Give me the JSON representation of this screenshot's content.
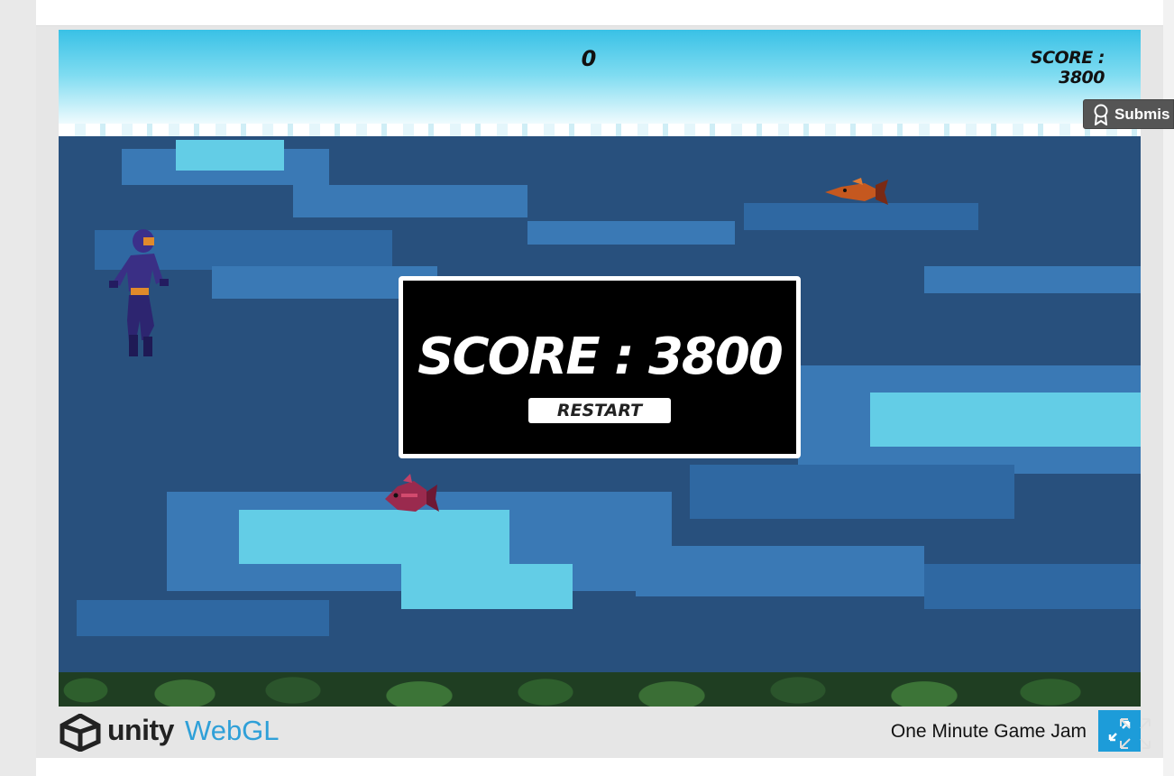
{
  "hud": {
    "timer": "0",
    "score": "SCORE : 3800"
  },
  "dialog": {
    "score": "SCORE : 3800",
    "restart_label": "RESTART"
  },
  "submission": {
    "label": "Submis",
    "icon": "ribbon-icon"
  },
  "footer": {
    "unity_label": "unity",
    "webgl_label": "WebGL",
    "game_title": "One Minute Game Jam",
    "fullscreen_icon": "fullscreen-icon"
  },
  "colors": {
    "water": "#28507d",
    "sky": "#39c1e6",
    "webgl_blue": "#2fa0d8",
    "fullscreen_bg": "#1d9cd9",
    "dialog_bg": "#000000"
  }
}
